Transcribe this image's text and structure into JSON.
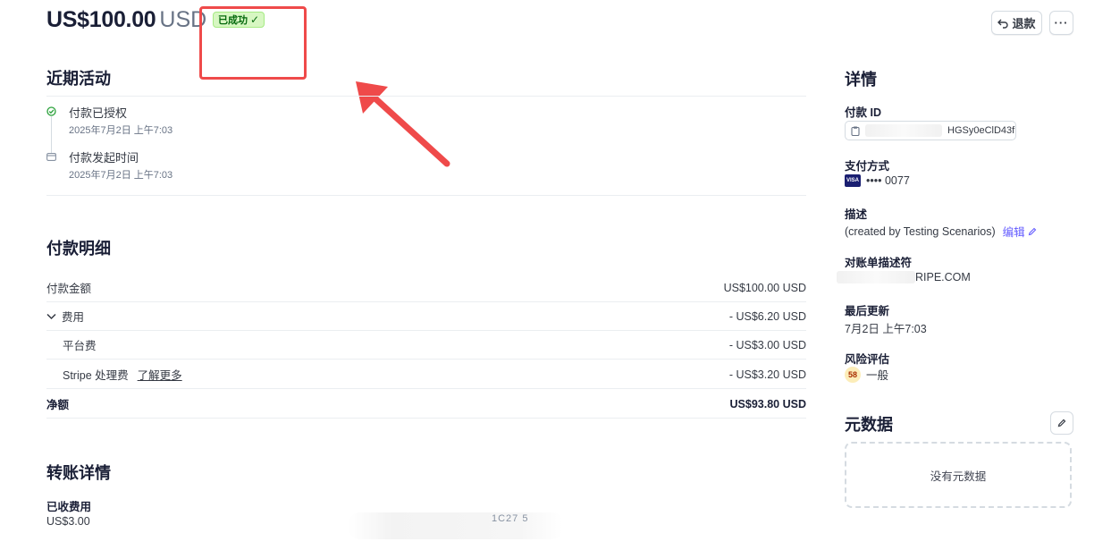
{
  "header": {
    "amount": "US$100.00",
    "currency": "USD",
    "status": "已成功",
    "status_check": "✓",
    "refund_label": "退款",
    "more_label": "···"
  },
  "activity": {
    "title": "近期活动",
    "items": [
      {
        "title": "付款已授权",
        "time": "2025年7月2日 上午7:03",
        "icon": "check-circle-icon"
      },
      {
        "title": "付款发起时间",
        "time": "2025年7月2日 上午7:03",
        "icon": "card-icon"
      }
    ]
  },
  "breakdown": {
    "title": "付款明细",
    "rows": [
      {
        "label": "付款金额",
        "value": "US$100.00 USD"
      },
      {
        "label": "费用",
        "value": "- US$6.20 USD"
      },
      {
        "label": "平台费",
        "value": "- US$3.00 USD"
      },
      {
        "label": "Stripe 处理费",
        "link": "了解更多",
        "value": "- US$3.20 USD"
      },
      {
        "label": "净额",
        "value": "US$93.80 USD"
      }
    ]
  },
  "transfer": {
    "title": "转账详情",
    "fee_label": "已收费用",
    "fee_value": "US$3.00",
    "partial": "1C27 5"
  },
  "details": {
    "title": "详情",
    "payment_id_label": "付款 ID",
    "payment_id_value": "HGSy0eClD43f",
    "method_label": "支付方式",
    "method_brand": "VISA",
    "method_value": "•••• 0077",
    "desc_label": "描述",
    "desc_value": "(created by Testing Scenarios)",
    "desc_edit": "编辑",
    "statement_label": "对账单描述符",
    "statement_value": "RIPE.COM",
    "updated_label": "最后更新",
    "updated_value": "7月2日 上午7:03",
    "risk_label": "风险评估",
    "risk_score": "58",
    "risk_level": "一般"
  },
  "metadata": {
    "title": "元数据",
    "empty": "没有元数据"
  },
  "colors": {
    "annotation": "#ef4a4a",
    "badge_bg": "#d7f7c2",
    "link": "#635bff"
  }
}
